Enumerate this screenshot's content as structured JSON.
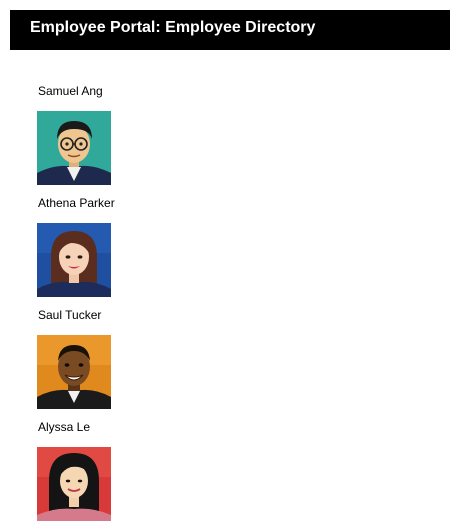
{
  "header": {
    "title": "Employee Portal: Employee Directory"
  },
  "employees": [
    {
      "name": "Samuel Ang",
      "avatar_icon": "man-with-glasses-avatar-icon",
      "bg_color": "#2a9d8f"
    },
    {
      "name": "Athena Parker",
      "avatar_icon": "woman-brown-hair-avatar-icon",
      "bg_color": "#1f4fa0"
    },
    {
      "name": "Saul Tucker",
      "avatar_icon": "man-smiling-avatar-icon",
      "bg_color": "#e08a1e"
    },
    {
      "name": "Alyssa Le",
      "avatar_icon": "woman-dark-hair-avatar-icon",
      "bg_color": "#d83a3a"
    }
  ]
}
